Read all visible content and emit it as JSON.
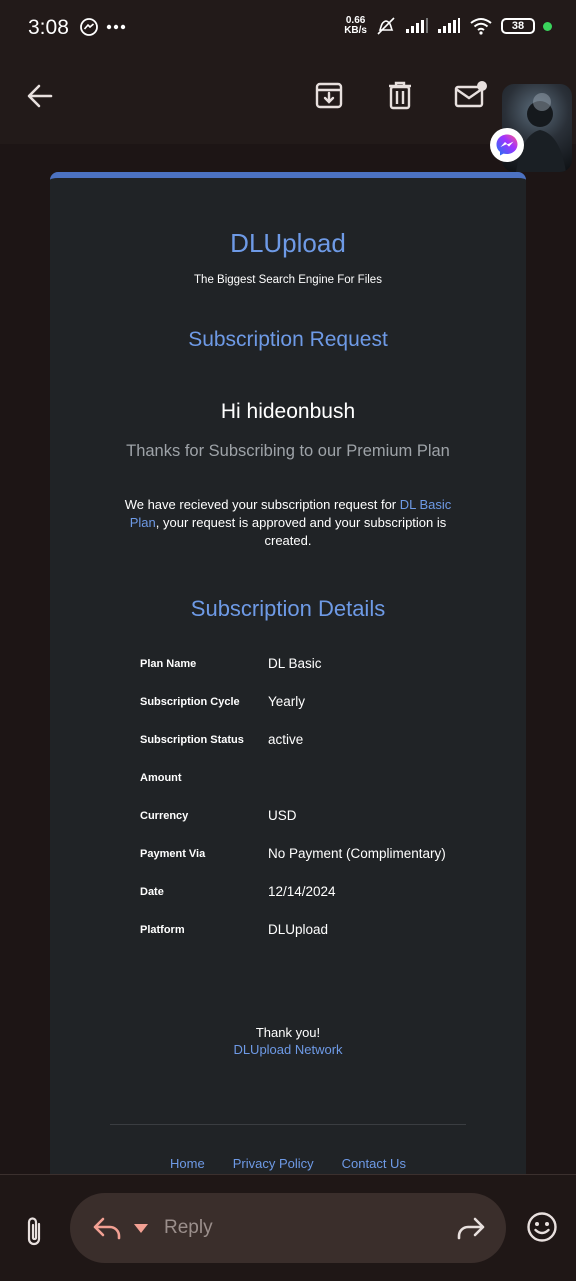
{
  "status": {
    "time": "3:08",
    "net_speed_value": "0.66",
    "net_speed_unit": "KB/s",
    "battery": "38"
  },
  "email": {
    "brand": "DLUpload",
    "tagline": "The Biggest Search Engine For Files",
    "heading": "Subscription Request",
    "greeting": "Hi hideonbush",
    "thanks": "Thanks for Subscribing to our Premium Plan",
    "body_pre": "We have recieved your subscription request for ",
    "body_link": "DL Basic Plan",
    "body_post": ", your request is approved and your subscription is created.",
    "details_title": "Subscription Details",
    "details": [
      {
        "key": "Plan Name",
        "value": "DL Basic"
      },
      {
        "key": "Subscription Cycle",
        "value": "Yearly"
      },
      {
        "key": "Subscription Status",
        "value": "active"
      },
      {
        "key": "Amount",
        "value": ""
      },
      {
        "key": "Currency",
        "value": "USD"
      },
      {
        "key": "Payment Via",
        "value": "No Payment (Complimentary)"
      },
      {
        "key": "Date",
        "value": "12/14/2024"
      },
      {
        "key": "Platform",
        "value": "DLUpload"
      }
    ],
    "closing": "Thank you!",
    "signature": "DLUpload Network",
    "footer_links": [
      "Home",
      "Privacy Policy",
      "Contact Us"
    ]
  },
  "compose": {
    "reply_label": "Reply"
  },
  "colors": {
    "accent": "#6e9ae6",
    "card": "#202326",
    "chrome": "#221a19"
  }
}
